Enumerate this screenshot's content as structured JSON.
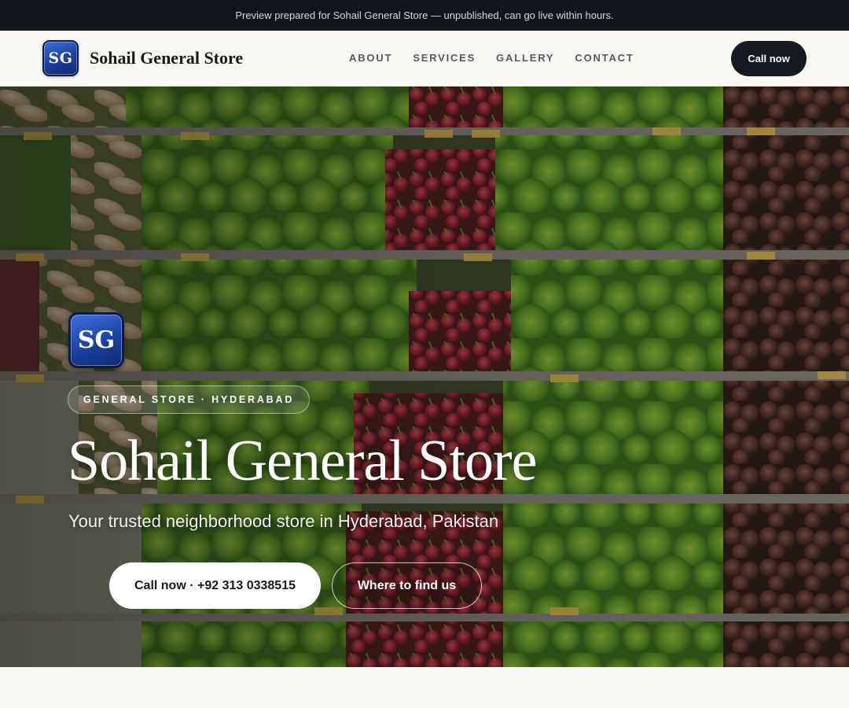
{
  "preview_banner": {
    "text": "Preview prepared for Sohail General Store — unpublished, can go live within hours."
  },
  "header": {
    "logo_text": "SG",
    "brand_name": "Sohail General Store",
    "nav": [
      "ABOUT",
      "SERVICES",
      "GALLERY",
      "CONTACT"
    ],
    "call_button": "Call now"
  },
  "hero": {
    "logo_text": "SG",
    "tag": "GENERAL STORE · HYDERABAD",
    "title": "Sohail General Store",
    "subtitle": "Your trusted neighborhood store in Hyderabad, Pakistan",
    "primary_button": "Call now · +92 313 0338515",
    "secondary_button": "Where to find us",
    "background_icon": "produce-shelves-photo"
  },
  "colors": {
    "banner_bg": "#12151b",
    "page_bg": "#f9f8f4",
    "dark_button": "#16191f",
    "logo_blue": "#1a3f9c"
  }
}
